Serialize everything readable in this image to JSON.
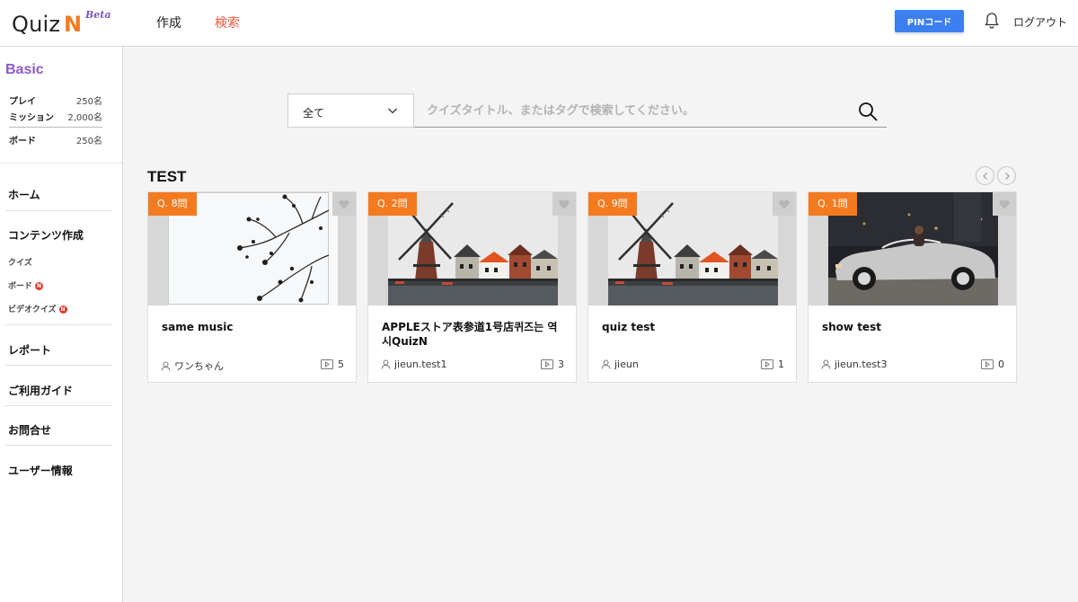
{
  "header": {
    "logo_text": "Quiz",
    "logo_n": "N",
    "logo_beta": "Beta",
    "nav": [
      {
        "label": "作成"
      },
      {
        "label": "検索"
      }
    ],
    "pin_button": "PINコード",
    "logout": "ログアウト"
  },
  "sidebar": {
    "plan": "Basic",
    "stats": [
      {
        "label": "プレイ",
        "value": "250名"
      },
      {
        "label": "ミッション",
        "value": "2,000名"
      },
      {
        "label": "ボード",
        "value": "250名"
      }
    ],
    "menu": {
      "home": "ホーム",
      "content_create": "コンテンツ作成",
      "sub": [
        {
          "label": "クイズ"
        },
        {
          "label": "ボード",
          "badge": "N"
        },
        {
          "label": "ビデオクイズ",
          "badge": "N"
        }
      ],
      "report": "レポート",
      "guide": "ご利用ガイド",
      "contact": "お問合せ",
      "user_info": "ユーザー情報"
    }
  },
  "search": {
    "filter_value": "全て",
    "placeholder": "クイズタイトル、またはタグで検索してください。"
  },
  "section": {
    "title": "TEST"
  },
  "cards": [
    {
      "badge": "Q. 8問",
      "title": "same music",
      "author": "ワンちゃん",
      "count": "5",
      "image": "branches"
    },
    {
      "badge": "Q. 2問",
      "title": "APPLEストア表参道1号店퀴즈는 역시QuizN",
      "author": "jieun.test1",
      "count": "3",
      "image": "windmill"
    },
    {
      "badge": "Q. 9問",
      "title": "quiz test",
      "author": "jieun",
      "count": "1",
      "image": "windmill"
    },
    {
      "badge": "Q. 1問",
      "title": "show test",
      "author": "jieun.test3",
      "count": "0",
      "image": "car"
    }
  ],
  "colors": {
    "accent": "#f47a20",
    "nav_active": "#f05a3c",
    "pin_button": "#3b7ff0",
    "plan": "#8e5ac9"
  }
}
